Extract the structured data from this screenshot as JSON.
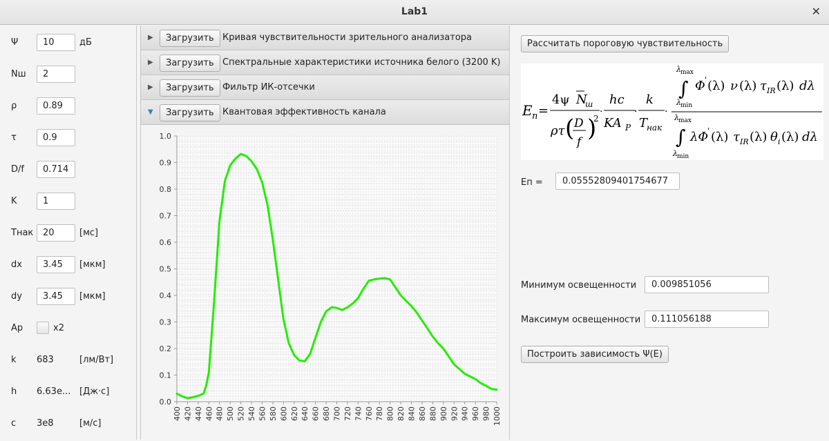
{
  "window": {
    "title": "Lab1"
  },
  "params": [
    {
      "label": "Ψ",
      "value": "10",
      "unit": "дБ"
    },
    {
      "label": "Nш",
      "value": "2",
      "unit": ""
    },
    {
      "label": "ρ",
      "value": "0.89",
      "unit": ""
    },
    {
      "label": "τ",
      "value": "0.9",
      "unit": ""
    },
    {
      "label": "D/f",
      "value": "0.714",
      "unit": ""
    },
    {
      "label": "K",
      "value": "1",
      "unit": ""
    },
    {
      "label": "Tнак",
      "value": "20",
      "unit": "[мс]"
    },
    {
      "label": "dx",
      "value": "3.45",
      "unit": "[мкм]"
    },
    {
      "label": "dy",
      "value": "3.45",
      "unit": "[мкм]"
    }
  ],
  "ap": {
    "label": "Ap",
    "checkbox_label": "x2"
  },
  "constants": [
    {
      "label": "k",
      "value": "683",
      "unit": "[лм/Вт]"
    },
    {
      "label": "h",
      "value": "6.63e...",
      "unit": "[Дж·с]"
    },
    {
      "label": "c",
      "value": "3e8",
      "unit": "[м/с]"
    }
  ],
  "accordion": [
    {
      "button": "Загрузить",
      "title": "Кривая чувствительности зрительного анализатора",
      "expanded": false
    },
    {
      "button": "Загрузить",
      "title": "Спектральные характеристики источника белого (3200 K)",
      "expanded": false
    },
    {
      "button": "Загрузить",
      "title": "Фильтр ИК-отсечки",
      "expanded": false
    },
    {
      "button": "Загрузить",
      "title": "Квантовая эффективность канала",
      "expanded": true
    }
  ],
  "chart_data": {
    "type": "line",
    "title": "",
    "xlabel": "",
    "ylabel": "",
    "xlim": [
      400,
      1000
    ],
    "ylim": [
      0,
      1.0
    ],
    "x_ticks": [
      400,
      420,
      440,
      460,
      480,
      500,
      520,
      540,
      560,
      580,
      600,
      620,
      640,
      660,
      680,
      700,
      720,
      740,
      760,
      780,
      800,
      820,
      840,
      860,
      880,
      900,
      920,
      940,
      960,
      980,
      1000
    ],
    "y_ticks": [
      0.0,
      0.1,
      0.2,
      0.3,
      0.4,
      0.5,
      0.6,
      0.7,
      0.8,
      0.9,
      1.0
    ],
    "grid": true,
    "line_color": "#22ee00",
    "series": [
      {
        "x": [
          400,
          410,
          420,
          430,
          440,
          450,
          455,
          460,
          470,
          480,
          490,
          500,
          510,
          520,
          530,
          540,
          550,
          560,
          570,
          580,
          590,
          600,
          610,
          620,
          630,
          640,
          650,
          660,
          670,
          680,
          690,
          700,
          710,
          720,
          730,
          740,
          750,
          760,
          770,
          780,
          790,
          800,
          810,
          820,
          830,
          840,
          850,
          860,
          870,
          880,
          890,
          900,
          910,
          920,
          930,
          940,
          950,
          960,
          970,
          980,
          990,
          1000
        ],
        "y": [
          0.03,
          0.02,
          0.013,
          0.017,
          0.022,
          0.03,
          0.06,
          0.11,
          0.38,
          0.68,
          0.83,
          0.89,
          0.915,
          0.932,
          0.925,
          0.905,
          0.875,
          0.825,
          0.74,
          0.61,
          0.46,
          0.31,
          0.22,
          0.175,
          0.155,
          0.152,
          0.18,
          0.24,
          0.3,
          0.34,
          0.355,
          0.353,
          0.345,
          0.355,
          0.37,
          0.39,
          0.425,
          0.455,
          0.46,
          0.463,
          0.465,
          0.46,
          0.43,
          0.4,
          0.38,
          0.36,
          0.335,
          0.305,
          0.275,
          0.245,
          0.22,
          0.2,
          0.17,
          0.14,
          0.123,
          0.105,
          0.095,
          0.085,
          0.07,
          0.06,
          0.048,
          0.045
        ]
      }
    ]
  },
  "right": {
    "calc_button": "Рассчитать пороговую чувствительность",
    "ep_label": "Eп =",
    "ep_value": "0.05552809401754677",
    "min_label": "Минимум освещенности",
    "min_value": "0.009851056",
    "max_label": "Максимум освещенности",
    "max_value": "0.111056188",
    "plot_button": "Построить зависимость Ψ(E)"
  },
  "formula": {
    "lhs": "E",
    "lhs_sub": "п",
    "f1_num": "4ψ",
    "f1_num_n": "N",
    "f1_num_n_sub": "ш",
    "f1_den_left": "ρτ",
    "f1_den_d": "D",
    "f1_den_f": "f",
    "f1_den_exp": "2",
    "f2_num": "hc",
    "f2_den": "KA",
    "f2_den_sub": "P",
    "f3_num": "k",
    "f3_den": "T",
    "f3_den_sub": "нак",
    "lambda_max": "λ",
    "max_sub": "max",
    "lambda_min": "λ",
    "min_sub": "min",
    "int_top": "∫",
    "int_bottom": "∫",
    "top_phi": "Φ",
    "prime": "'",
    "top_lam1": "(λ)",
    "top_nu": "ν",
    "top_lam2": "(λ)",
    "top_tau": "τ",
    "tau_sub": "IR",
    "top_lam3": "(λ)",
    "top_d": "dλ",
    "bot_lam": "λΦ",
    "bot_lam1": "(λ)",
    "bot_tau": "τ",
    "bot_lam2": "(λ)",
    "bot_theta": "θ",
    "theta_sub": "i",
    "bot_lam3": "(λ)",
    "bot_d": "dλ"
  }
}
